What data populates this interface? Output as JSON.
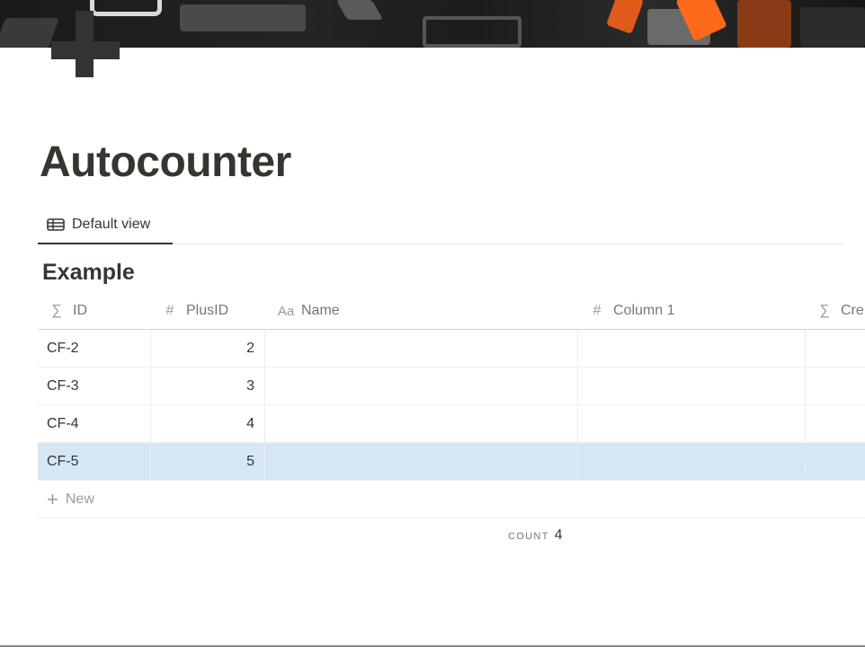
{
  "page": {
    "title": "Autocounter",
    "icon": "plus-icon"
  },
  "views": [
    {
      "label": "Default view",
      "icon": "table-icon",
      "active": true
    }
  ],
  "database": {
    "title": "Example",
    "columns": [
      {
        "label": "ID",
        "icon": "formula-icon",
        "glyph": "∑"
      },
      {
        "label": "PlusID",
        "icon": "number-icon",
        "glyph": "#"
      },
      {
        "label": "Name",
        "icon": "text-icon",
        "glyph": "Aa"
      },
      {
        "label": "Column 1",
        "icon": "number-icon",
        "glyph": "#"
      },
      {
        "label": "Cre",
        "icon": "formula-icon",
        "glyph": "∑"
      }
    ],
    "rows": [
      {
        "id": "CF-2",
        "plus_id": "2",
        "name": "",
        "column_1": "",
        "cre": "",
        "selected": false
      },
      {
        "id": "CF-3",
        "plus_id": "3",
        "name": "",
        "column_1": "",
        "cre": "",
        "selected": false
      },
      {
        "id": "CF-4",
        "plus_id": "4",
        "name": "",
        "column_1": "",
        "cre": "",
        "selected": false
      },
      {
        "id": "CF-5",
        "plus_id": "5",
        "name": "",
        "column_1": "",
        "cre": "",
        "selected": true
      }
    ],
    "new_row_label": "New",
    "calculation": {
      "label": "COUNT",
      "value": "4"
    }
  },
  "colors": {
    "text": "#37352f",
    "muted": "#787774",
    "selection": "#d3e5f5",
    "cover_accent": "#ff6a1a"
  }
}
